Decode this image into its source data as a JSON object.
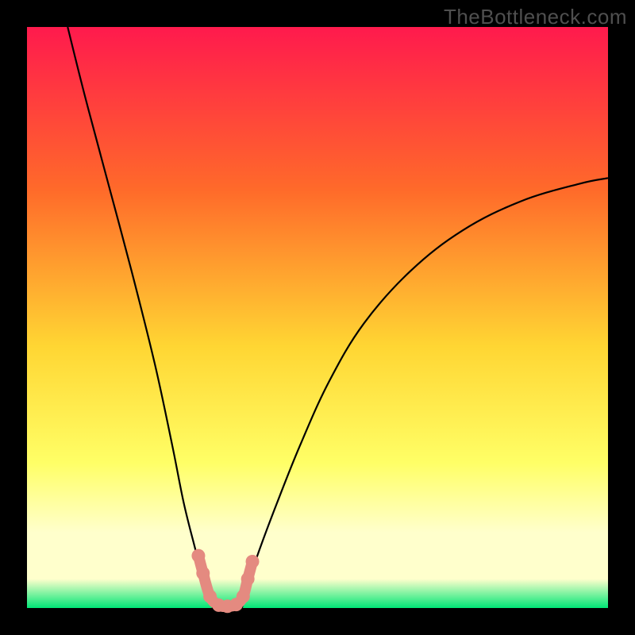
{
  "watermark": "TheBottleneck.com",
  "colors": {
    "frame": "#000000",
    "gradient_top": "#ff1a4d",
    "gradient_mid_upper": "#ff6a2a",
    "gradient_mid": "#ffd633",
    "gradient_mid_lower": "#ffff66",
    "gradient_pale": "#ffffcc",
    "gradient_bottom": "#00e676",
    "curve": "#000000",
    "markers": "#e48a80"
  },
  "chart_data": {
    "type": "line",
    "title": "",
    "xlabel": "",
    "ylabel": "",
    "x_range": [
      0,
      100
    ],
    "y_range": [
      0,
      100
    ],
    "series": [
      {
        "name": "left-branch",
        "x": [
          7,
          10,
          14,
          18,
          22,
          25,
          27,
          29,
          30,
          31,
          32
        ],
        "y": [
          100,
          88,
          73,
          58,
          42,
          28,
          18,
          10,
          6,
          3,
          0
        ]
      },
      {
        "name": "right-branch",
        "x": [
          37,
          38,
          40,
          43,
          47,
          52,
          58,
          66,
          75,
          85,
          95,
          100
        ],
        "y": [
          0,
          4,
          10,
          18,
          28,
          39,
          49,
          58,
          65,
          70,
          73,
          74
        ]
      },
      {
        "name": "valley-floor",
        "x": [
          32,
          33.5,
          35,
          36,
          37
        ],
        "y": [
          0,
          0,
          0,
          0,
          0
        ]
      }
    ],
    "markers": [
      {
        "x": 29.5,
        "y": 9
      },
      {
        "x": 30.3,
        "y": 6
      },
      {
        "x": 31.5,
        "y": 2
      },
      {
        "x": 33.0,
        "y": 0.5
      },
      {
        "x": 34.5,
        "y": 0.3
      },
      {
        "x": 36.0,
        "y": 0.6
      },
      {
        "x": 37.2,
        "y": 2
      },
      {
        "x": 38.0,
        "y": 5
      },
      {
        "x": 38.8,
        "y": 8
      }
    ]
  }
}
